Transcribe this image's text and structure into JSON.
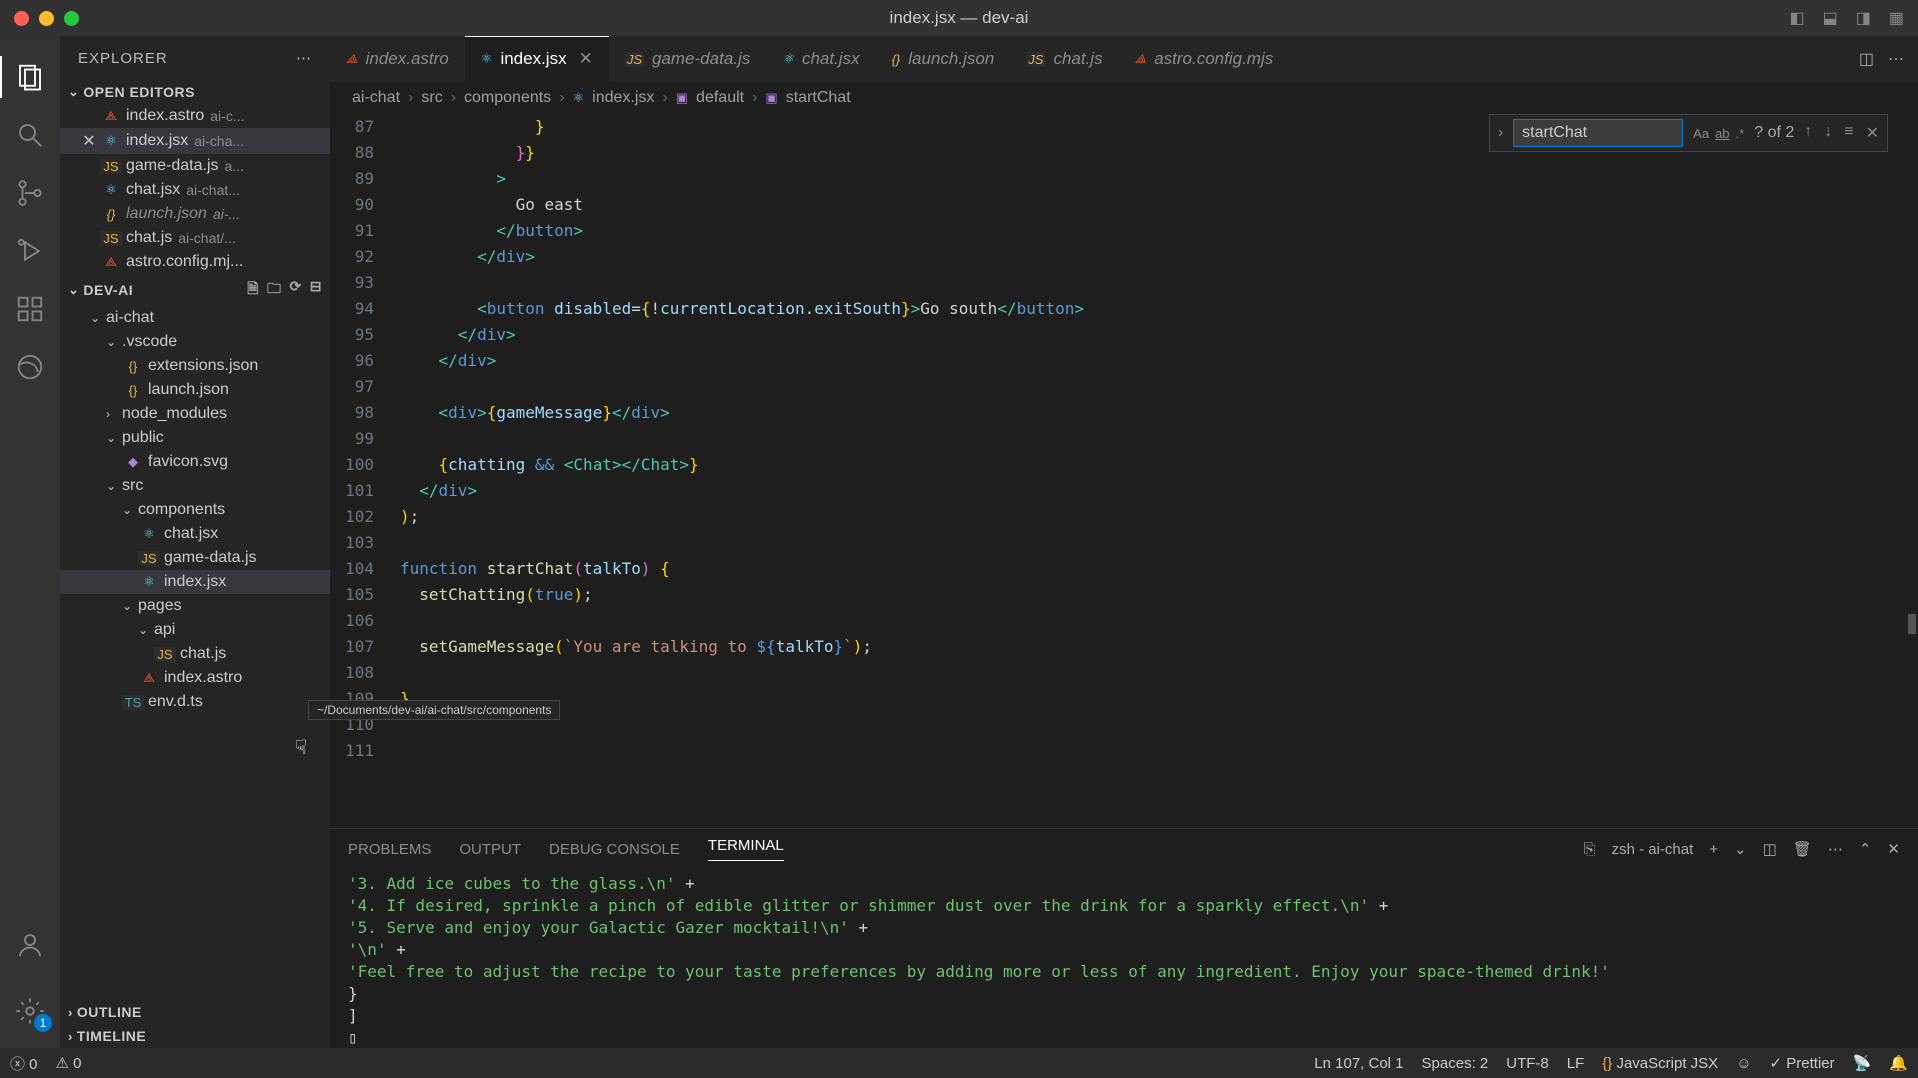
{
  "window_title": "index.jsx — dev-ai",
  "explorer_title": "EXPLORER",
  "open_editors_label": "OPEN EDITORS",
  "project_label": "DEV-AI",
  "outline_label": "OUTLINE",
  "timeline_label": "TIMELINE",
  "open_editors": [
    {
      "icon": "astro",
      "name": "index.astro",
      "meta": "ai-c..."
    },
    {
      "icon": "react",
      "name": "index.jsx",
      "meta": "ai-cha...",
      "active": true
    },
    {
      "icon": "js",
      "name": "game-data.js",
      "meta": "a..."
    },
    {
      "icon": "react",
      "name": "chat.jsx",
      "meta": "ai-chat..."
    },
    {
      "icon": "json",
      "name": "launch.json",
      "meta": "ai-...",
      "dim": true
    },
    {
      "icon": "js",
      "name": "chat.js",
      "meta": "ai-chat/..."
    },
    {
      "icon": "astro",
      "name": "astro.config.mj...",
      "meta": ""
    }
  ],
  "tree": {
    "ai_chat": "ai-chat",
    "vscode": ".vscode",
    "extensions": "extensions.json",
    "launch": "launch.json",
    "node_modules": "node_modules",
    "public": "public",
    "favicon": "favicon.svg",
    "src": "src",
    "components": "components",
    "chat_jsx": "chat.jsx",
    "game_data": "game-data.js",
    "index_jsx": "index.jsx",
    "pages": "pages",
    "api": "api",
    "chat_js": "chat.js",
    "index_astro": "index.astro",
    "env": "env.d.ts"
  },
  "tabs": [
    {
      "icon": "astro",
      "label": "index.astro"
    },
    {
      "icon": "react",
      "label": "index.jsx",
      "active": true,
      "close": true
    },
    {
      "icon": "js",
      "label": "game-data.js"
    },
    {
      "icon": "react",
      "label": "chat.jsx"
    },
    {
      "icon": "json",
      "label": "launch.json",
      "dim": true
    },
    {
      "icon": "js",
      "label": "chat.js"
    },
    {
      "icon": "astro",
      "label": "astro.config.mjs"
    }
  ],
  "breadcrumb": [
    "ai-chat",
    "src",
    "components",
    "index.jsx",
    "default",
    "startChat"
  ],
  "gutter": [
    "87",
    "88",
    "89",
    "90",
    "91",
    "92",
    "93",
    "94",
    "95",
    "96",
    "97",
    "98",
    "99",
    "100",
    "101",
    "102",
    "103",
    "104",
    "105",
    "106",
    "107",
    "108",
    "109",
    "110",
    "111"
  ],
  "search": {
    "value": "startChat",
    "count": "? of 2"
  },
  "panel": {
    "tabs": [
      "PROBLEMS",
      "OUTPUT",
      "DEBUG CONSOLE",
      "TERMINAL"
    ],
    "active": 3,
    "shell": "zsh - ai-chat",
    "lines": [
      {
        "t": "str",
        "text": "'3. Add ice cubes to the glass.\\n'",
        "suffix": " +"
      },
      {
        "t": "str",
        "text": "'4. If desired, sprinkle a pinch of edible glitter or shimmer dust over the drink for a sparkly effect.\\n'",
        "suffix": " +"
      },
      {
        "t": "str",
        "text": "'5. Serve and enjoy your Galactic Gazer mocktail!\\n'",
        "suffix": " +"
      },
      {
        "t": "str",
        "text": "'\\n'",
        "suffix": " +"
      },
      {
        "t": "str",
        "text": "'Feel free to adjust the recipe to your taste preferences by adding more or less of any ingredient. Enjoy your space-themed drink!'",
        "suffix": ""
      },
      {
        "t": "plain",
        "text": "  }"
      },
      {
        "t": "plain",
        "text": "]"
      },
      {
        "t": "plain",
        "text": "▯"
      }
    ]
  },
  "status": {
    "errors": "0",
    "warnings": "0",
    "pos": "Ln 107, Col 1",
    "spaces": "Spaces: 2",
    "enc": "UTF-8",
    "eol": "LF",
    "lang": "JavaScript JSX",
    "prettier": "Prettier"
  },
  "tooltip": "~/Documents/dev-ai/ai-chat/src/components",
  "settings_badge": "1"
}
